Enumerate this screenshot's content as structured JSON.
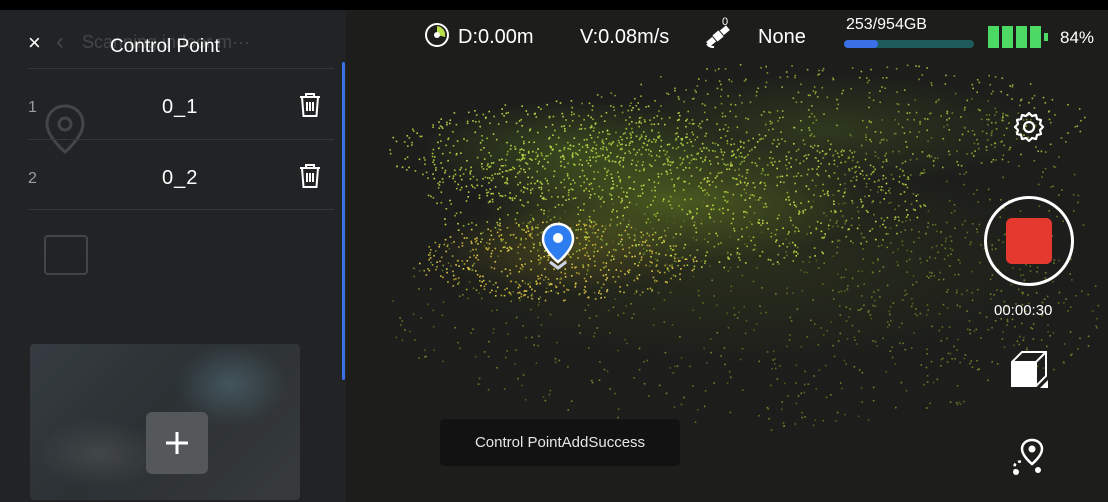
{
  "panel": {
    "title": "Control Point",
    "close_label": "×",
    "background_title": "Scanning indoor m···",
    "items": [
      {
        "index": "1",
        "name": "0_1"
      },
      {
        "index": "2",
        "name": "0_2"
      }
    ],
    "add_label": "+"
  },
  "status": {
    "distance": "D:0.00m",
    "velocity": "V:0.08m/s",
    "satellite_count": "0",
    "gnss_status": "None",
    "storage": "253/954GB",
    "storage_used_fraction": 0.265,
    "battery": "84%",
    "battery_level": 0.84
  },
  "controls": {
    "timer": "00:00:30",
    "record_color": "#e5392f"
  },
  "toast": {
    "message": "Control PointAddSuccess"
  },
  "colors": {
    "accent": "#3a6fe6",
    "battery": "#4cd964",
    "panel_bg": "#212325"
  },
  "icons": [
    "close-icon",
    "delete-icon",
    "plus-icon",
    "settings-icon",
    "record-stop-icon",
    "cube-view-icon",
    "route-icon",
    "satellite-icon",
    "distance-icon",
    "battery-icon",
    "location-pin-icon"
  ]
}
